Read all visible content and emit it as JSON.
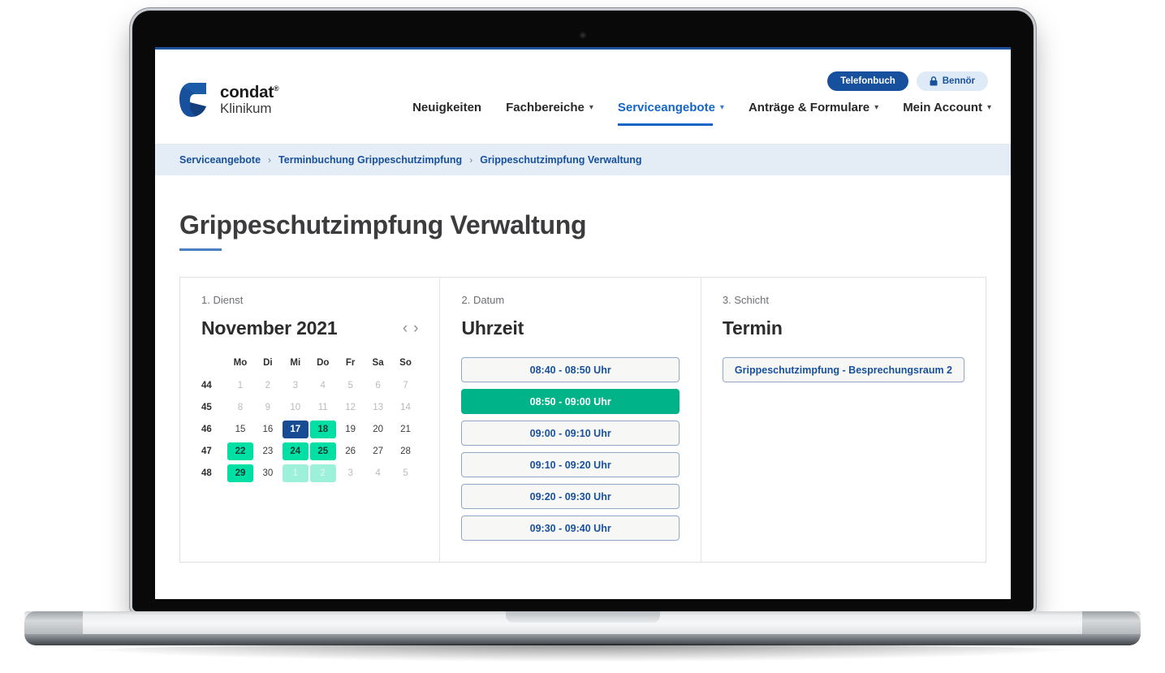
{
  "brand": {
    "name": "condat",
    "registered": "®",
    "sub": "Klinikum",
    "logo_color": "#17519e"
  },
  "header": {
    "phonebook_label": "Telefonbuch",
    "account_label": "Bennör",
    "lock_icon": "lock-icon",
    "nav": [
      {
        "label": "Neuigkeiten",
        "has_caret": false,
        "active": false
      },
      {
        "label": "Fachbereiche",
        "has_caret": true,
        "active": false
      },
      {
        "label": "Serviceangebote",
        "has_caret": true,
        "active": true
      },
      {
        "label": "Anträge & Formulare",
        "has_caret": true,
        "active": false
      },
      {
        "label": "Mein Account",
        "has_caret": true,
        "active": false
      }
    ]
  },
  "breadcrumb": {
    "separator": "›",
    "items": [
      "Serviceangebote",
      "Terminbuchung Grippeschutzimpfung",
      "Grippeschutzimpfung Verwaltung"
    ]
  },
  "page": {
    "title": "Grippeschutzimpfung Verwaltung"
  },
  "booking": {
    "columns": {
      "dienst": {
        "step": "1. Dienst",
        "heading": "November 2021"
      },
      "datum": {
        "step": "2. Datum",
        "heading": "Uhrzeit"
      },
      "schicht": {
        "step": "3. Schicht",
        "heading": "Termin"
      }
    },
    "calendar": {
      "month_label": "November 2021",
      "prev_arrow": "‹",
      "next_arrow": "›",
      "weekday_headers": [
        "Mo",
        "Di",
        "Mi",
        "Do",
        "Fr",
        "Sa",
        "So"
      ],
      "weeks": [
        {
          "week": "44",
          "days": [
            {
              "n": "1",
              "state": "muted"
            },
            {
              "n": "2",
              "state": "muted"
            },
            {
              "n": "3",
              "state": "muted"
            },
            {
              "n": "4",
              "state": "muted"
            },
            {
              "n": "5",
              "state": "muted"
            },
            {
              "n": "6",
              "state": "muted"
            },
            {
              "n": "7",
              "state": "muted"
            }
          ]
        },
        {
          "week": "45",
          "days": [
            {
              "n": "8",
              "state": "muted"
            },
            {
              "n": "9",
              "state": "muted"
            },
            {
              "n": "10",
              "state": "muted"
            },
            {
              "n": "11",
              "state": "muted"
            },
            {
              "n": "12",
              "state": "muted"
            },
            {
              "n": "13",
              "state": "muted"
            },
            {
              "n": "14",
              "state": "muted"
            }
          ]
        },
        {
          "week": "46",
          "days": [
            {
              "n": "15",
              "state": "normal"
            },
            {
              "n": "16",
              "state": "normal"
            },
            {
              "n": "17",
              "state": "selected"
            },
            {
              "n": "18",
              "state": "avail"
            },
            {
              "n": "19",
              "state": "normal"
            },
            {
              "n": "20",
              "state": "normal"
            },
            {
              "n": "21",
              "state": "normal"
            }
          ]
        },
        {
          "week": "47",
          "days": [
            {
              "n": "22",
              "state": "avail"
            },
            {
              "n": "23",
              "state": "normal"
            },
            {
              "n": "24",
              "state": "avail"
            },
            {
              "n": "25",
              "state": "avail"
            },
            {
              "n": "26",
              "state": "normal"
            },
            {
              "n": "27",
              "state": "normal"
            },
            {
              "n": "28",
              "state": "normal"
            }
          ]
        },
        {
          "week": "48",
          "days": [
            {
              "n": "29",
              "state": "avail"
            },
            {
              "n": "30",
              "state": "normal"
            },
            {
              "n": "1",
              "state": "next"
            },
            {
              "n": "2",
              "state": "next"
            },
            {
              "n": "3",
              "state": "muted"
            },
            {
              "n": "4",
              "state": "muted"
            },
            {
              "n": "5",
              "state": "muted"
            }
          ]
        }
      ]
    },
    "time_slots": [
      {
        "label": "08:40 - 08:50 Uhr",
        "selected": false
      },
      {
        "label": "08:50 - 09:00 Uhr",
        "selected": true
      },
      {
        "label": "09:00 - 09:10 Uhr",
        "selected": false
      },
      {
        "label": "09:10 - 09:20 Uhr",
        "selected": false
      },
      {
        "label": "09:20 - 09:30 Uhr",
        "selected": false
      },
      {
        "label": "09:30 - 09:40 Uhr",
        "selected": false
      }
    ],
    "termin_options": [
      {
        "label": "Grippeschutzimpfung - Besprechungsraum 2",
        "selected": false
      }
    ]
  },
  "colors": {
    "brand_blue": "#17519e",
    "link_blue": "#1565c8",
    "accent_green": "#00e0a5",
    "selected_green": "#00b389",
    "selected_day_blue": "#174c95",
    "breadcrumb_bg": "#e4ecf6"
  }
}
